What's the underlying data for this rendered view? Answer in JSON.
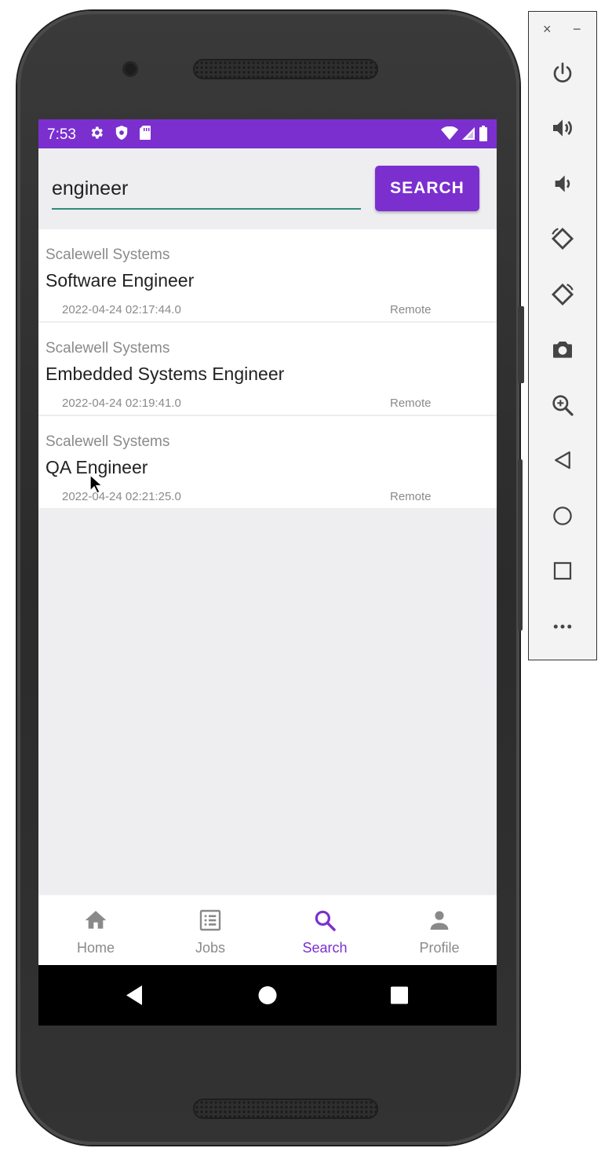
{
  "status_bar": {
    "time": "7:53",
    "icons": [
      "gear-icon",
      "shield-icon",
      "sd-card-icon"
    ],
    "right_icons": [
      "wifi-icon",
      "signal-icon",
      "battery-icon"
    ],
    "color": "#7b2fcf"
  },
  "search": {
    "value": "engineer",
    "button_label": "SEARCH",
    "accent": "#7b2fcf",
    "underline_color": "#2e8b7a"
  },
  "results": [
    {
      "company": "Scalewell Systems",
      "title": "Software Engineer",
      "date": "2022-04-24 02:17:44.0",
      "location": "Remote"
    },
    {
      "company": "Scalewell Systems",
      "title": "Embedded Systems Engineer",
      "date": "2022-04-24 02:19:41.0",
      "location": "Remote"
    },
    {
      "company": "Scalewell Systems",
      "title": "QA Engineer",
      "date": "2022-04-24 02:21:25.0",
      "location": "Remote"
    }
  ],
  "bottom_nav": {
    "items": [
      {
        "label": "Home",
        "icon": "home-icon",
        "active": false
      },
      {
        "label": "Jobs",
        "icon": "list-icon",
        "active": false
      },
      {
        "label": "Search",
        "icon": "search-icon",
        "active": true
      },
      {
        "label": "Profile",
        "icon": "person-icon",
        "active": false
      }
    ]
  },
  "android_nav": [
    "back-icon",
    "home-circle-icon",
    "recents-icon"
  ],
  "emulator_toolbar": {
    "close": "×",
    "minimize": "−",
    "buttons": [
      "power-icon",
      "volume-up-icon",
      "volume-down-icon",
      "rotate-left-icon",
      "rotate-right-icon",
      "camera-icon",
      "zoom-icon",
      "back-icon",
      "home-icon",
      "overview-icon",
      "more-icon"
    ]
  }
}
